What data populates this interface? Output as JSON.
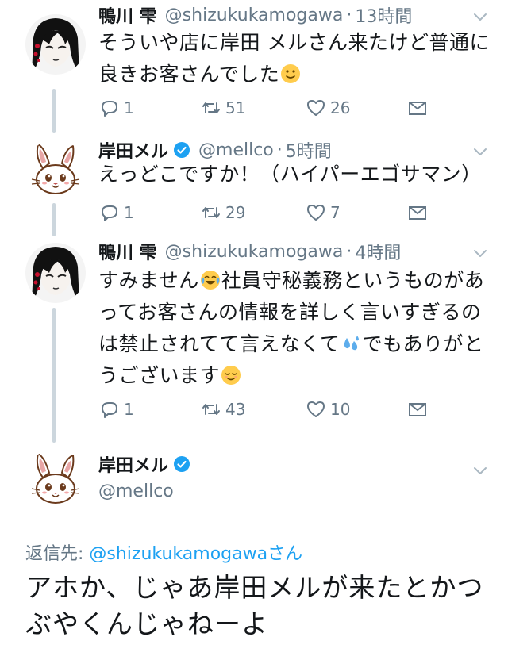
{
  "tweets": [
    {
      "name": "鴨川 雫",
      "handle": "@shizukukamogawa",
      "time": "13時間",
      "text": "そういや店に岸田 メルさん来たけど普通に良きお客さんでした",
      "emoji": "slightly-smiling-face",
      "replies": "1",
      "retweets": "51",
      "likes": "26"
    },
    {
      "name": "岸田メル",
      "handle": "@mellco",
      "time": "5時間",
      "verified": true,
      "text": "えっどこですか！（ハイパーエゴサマン）",
      "replies": "1",
      "retweets": "29",
      "likes": "7"
    },
    {
      "name": "鴨川 雫",
      "handle": "@shizukukamogawa",
      "time": "4時間",
      "text_a": "すみません",
      "text_b": "社員守秘義務というものがあってお客さんの情報を詳しく言いすぎるのは禁止されてて言えなくて",
      "text_c": "でもありがとうございます",
      "emojis": [
        "face-with-tears-of-joy",
        "sweat-droplets",
        "relieved-face"
      ],
      "replies": "1",
      "retweets": "43",
      "likes": "10"
    }
  ],
  "main_tweet": {
    "name": "岸田メル",
    "handle": "@mellco",
    "verified": true,
    "reply_prefix": "返信先: ",
    "reply_mention": "@shizukukamogawa",
    "reply_suffix": "さん",
    "text": "アホか、じゃあ岸田メルが来たとかつぶやくんじゃねーよ"
  },
  "icons": [
    "reply-icon",
    "retweet-icon",
    "like-icon",
    "message-icon",
    "chevron-down-icon",
    "verified-badge-icon"
  ],
  "colors": {
    "text": "#14171a",
    "secondary": "#657786",
    "link": "#1da1f2",
    "thread_line": "#ccd6dd"
  }
}
